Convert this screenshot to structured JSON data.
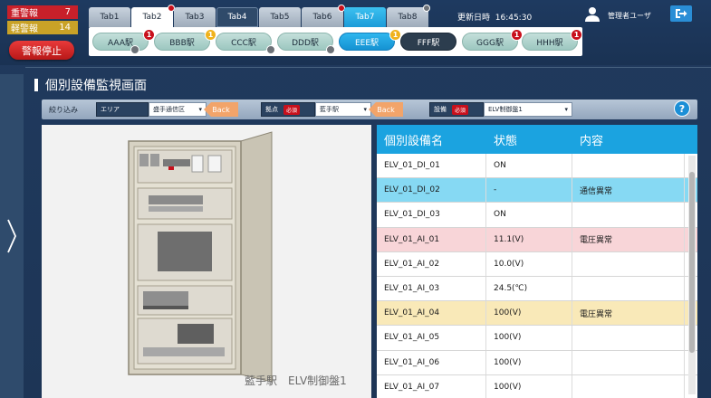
{
  "alarms": {
    "heavy_label": "重警報",
    "heavy_count": "7",
    "light_label": "軽警報",
    "light_count": "14",
    "stop_label": "警報停止"
  },
  "tabs": [
    {
      "label": "Tab1"
    },
    {
      "label": "Tab2"
    },
    {
      "label": "Tab3"
    },
    {
      "label": "Tab4"
    },
    {
      "label": "Tab5"
    },
    {
      "label": "Tab6"
    },
    {
      "label": "Tab7"
    },
    {
      "label": "Tab8"
    }
  ],
  "stations": [
    {
      "label": "AAA駅",
      "badge": "1"
    },
    {
      "label": "BBB駅",
      "badge": "1"
    },
    {
      "label": "CCC駅",
      "badge": ""
    },
    {
      "label": "DDD駅",
      "badge": ""
    },
    {
      "label": "EEE駅",
      "badge": "1"
    },
    {
      "label": "FFF駅",
      "badge": ""
    },
    {
      "label": "GGG駅",
      "badge": "1"
    },
    {
      "label": "HHH駅",
      "badge": "1"
    }
  ],
  "header": {
    "updated_label": "更新日時",
    "updated_time": "16:45:30",
    "user": "管理者ユーザ"
  },
  "page": {
    "title": "個別設備監視画面"
  },
  "filter": {
    "label": "絞り込み",
    "area_label": "エリア",
    "area_value": "盛手通信区",
    "back": "Back",
    "base_label": "拠点",
    "required": "必須",
    "base_value": "藍手駅",
    "equip_label": "設備",
    "equip_value": "ELV制御盤1",
    "help": "?"
  },
  "image": {
    "caption": "藍手駅　ELV制御盤1"
  },
  "table": {
    "headers": [
      "個別設備名",
      "状態",
      "内容"
    ],
    "rows": [
      {
        "name": "ELV_01_DI_01",
        "state": "ON",
        "detail": ""
      },
      {
        "name": "ELV_01_DI_02",
        "state": "-",
        "detail": "通信異常"
      },
      {
        "name": "ELV_01_DI_03",
        "state": "ON",
        "detail": ""
      },
      {
        "name": "ELV_01_AI_01",
        "state": "11.1(V)",
        "detail": "電圧異常"
      },
      {
        "name": "ELV_01_AI_02",
        "state": "10.0(V)",
        "detail": ""
      },
      {
        "name": "ELV_01_AI_03",
        "state": "24.5(℃)",
        "detail": ""
      },
      {
        "name": "ELV_01_AI_04",
        "state": "100(V)",
        "detail": "電圧異常"
      },
      {
        "name": "ELV_01_AI_05",
        "state": "100(V)",
        "detail": ""
      },
      {
        "name": "ELV_01_AI_06",
        "state": "100(V)",
        "detail": ""
      },
      {
        "name": "ELV_01_AI_07",
        "state": "100(V)",
        "detail": ""
      }
    ]
  },
  "colors": {
    "heavy_alarm": "#c8202a",
    "light_alarm": "#c9a227",
    "accent": "#1ba3e0",
    "row_cyan": "#86d9f3",
    "row_pink": "#f8d5d8",
    "row_yellow": "#f9e9b8"
  }
}
